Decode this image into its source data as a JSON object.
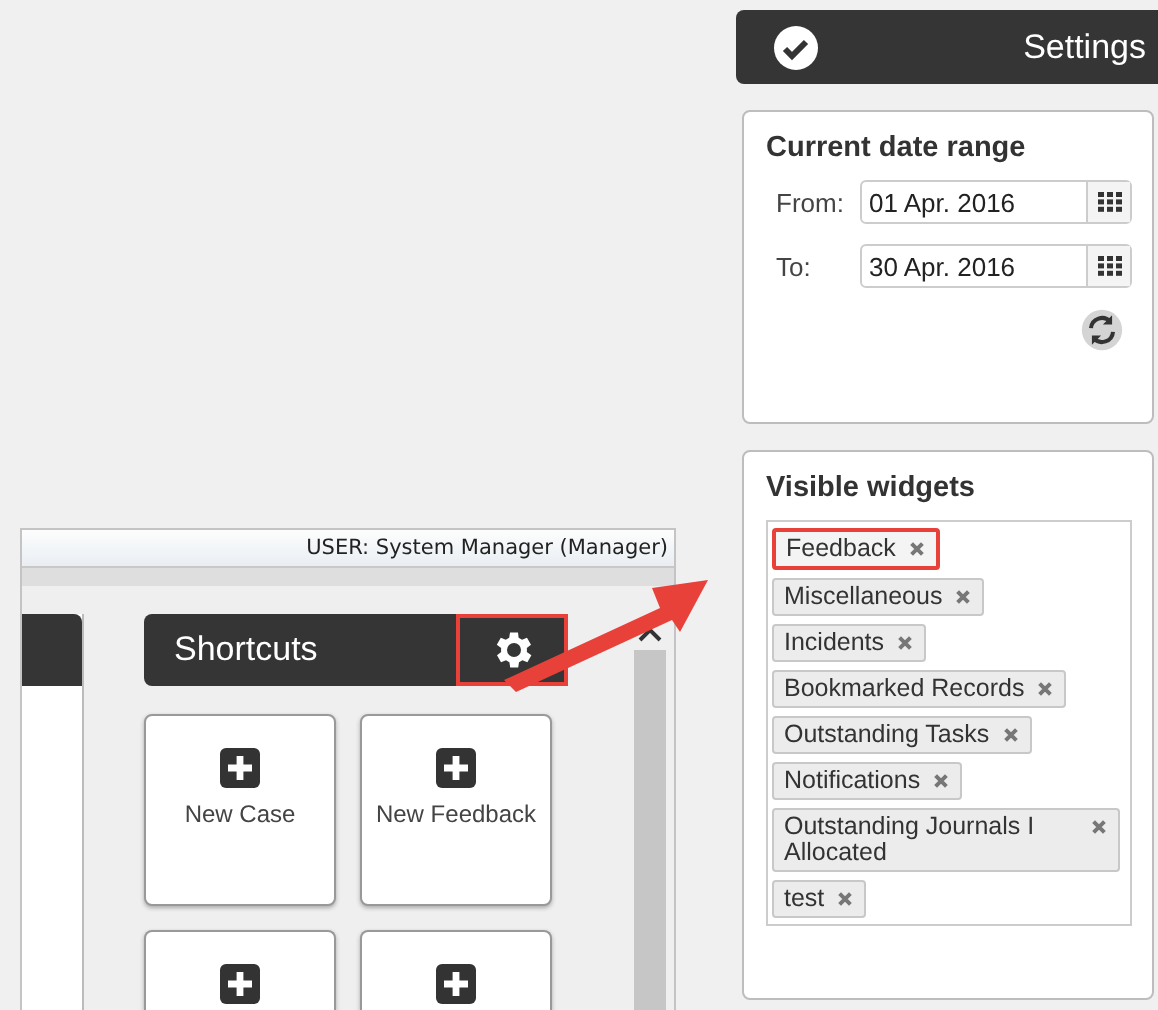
{
  "app": {
    "user_text": "USER: System Manager (Manager)",
    "shortcuts": {
      "title": "Shortcuts",
      "settings_highlighted": true,
      "tiles": [
        {
          "label": "New Case"
        },
        {
          "label": "New Feedback"
        }
      ]
    }
  },
  "settings_panel": {
    "title": "Settings",
    "date_range": {
      "title": "Current date range",
      "fields": [
        {
          "label": "From:",
          "value": "01 Apr. 2016"
        },
        {
          "label": "To:",
          "value": "30 Apr. 2016"
        }
      ]
    },
    "visible_widgets": {
      "title": "Visible widgets",
      "tags": [
        {
          "label": "Feedback",
          "highlighted": true
        },
        {
          "label": "Miscellaneous",
          "highlighted": false
        },
        {
          "label": "Incidents",
          "highlighted": false
        },
        {
          "label": "Bookmarked Records",
          "highlighted": false
        },
        {
          "label": "Outstanding Tasks",
          "highlighted": false
        },
        {
          "label": "Notifications",
          "highlighted": false
        },
        {
          "label": "Outstanding Journals I Allocated",
          "highlighted": false
        },
        {
          "label": "test",
          "highlighted": false
        }
      ]
    }
  }
}
